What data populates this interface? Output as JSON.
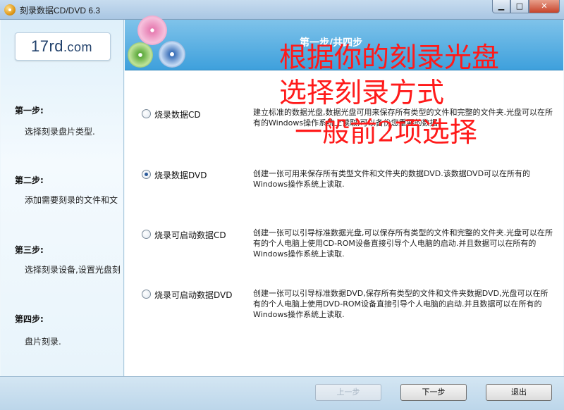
{
  "window": {
    "title": "刻录数据CD/DVD 6.3",
    "minimize": "▁",
    "maximize": "□",
    "close": "✕"
  },
  "logo": {
    "main": "17rd",
    "suffix": ".com"
  },
  "banner": {
    "title": "第一步/共四步"
  },
  "sidebar": {
    "steps": [
      {
        "title": "第一步:",
        "desc": "选择刻录盘片类型."
      },
      {
        "title": "第二步:",
        "desc": "添加需要刻录的文件和文"
      },
      {
        "title": "第三步:",
        "desc": "选择刻录设备,设置光盘刻"
      },
      {
        "title": "第四步:",
        "desc": "盘片刻录."
      }
    ]
  },
  "options": [
    {
      "label": "烧录数据CD",
      "checked": false,
      "desc": "建立标准的数据光盘,数据光盘可用来保存所有类型的文件和完整的文件夹.光盘可以在所有的Windows操作系统上读取,可以备份您重要的数据."
    },
    {
      "label": "烧录数据DVD",
      "checked": true,
      "desc": "创建一张可用来保存所有类型文件和文件夹的数据DVD.该数据DVD可以在所有的Windows操作系统上读取."
    },
    {
      "label": "烧录可启动数据CD",
      "checked": false,
      "desc": "创建一张可以引导标准数据光盘,可以保存所有类型的文件和完整的文件夹.光盘可以在所有的个人电脑上使用CD-ROM设备直接引导个人电脑的启动.并且数据可以在所有的Windows操作系统上读取."
    },
    {
      "label": "烧录可启动数据DVD",
      "checked": false,
      "desc": "创建一张可以引导标准数据DVD,保存所有类型的文件和文件夹数据DVD,光盘可以在所有的个人电脑上使用DVD-ROM设备直接引导个人电脑的启动.并且数据可以在所有的Windows操作系统上读取."
    }
  ],
  "annotation": {
    "line1": "根据你的刻录光盘",
    "line2": "选择刻录方式",
    "line3": "一般前2项选择",
    "color": "#ff1a1a"
  },
  "buttons": {
    "prev": "上一步",
    "next": "下一步",
    "exit": "退出"
  }
}
